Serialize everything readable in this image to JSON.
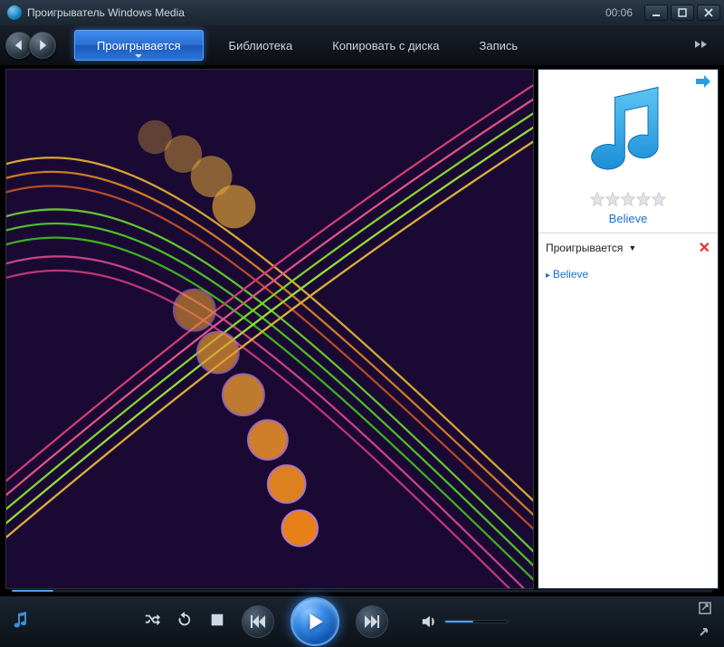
{
  "titlebar": {
    "title": "Проигрыватель Windows Media",
    "clock": "00:06"
  },
  "tabs": {
    "now_playing": "Проигрывается",
    "library": "Библиотека",
    "rip": "Копировать с диска",
    "burn": "Запись"
  },
  "sidebar": {
    "song_title": "Believe",
    "playlist_header": "Проигрывается",
    "items": [
      {
        "label": "Believe"
      }
    ]
  }
}
